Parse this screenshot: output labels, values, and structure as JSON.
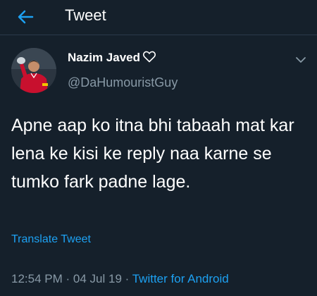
{
  "header": {
    "title": "Tweet",
    "back_icon": "arrow-left-icon"
  },
  "author": {
    "name": "Nazim Javed",
    "name_badge_icon": "heart-outline-icon",
    "handle": "@DaHumouristGuy"
  },
  "tweet": {
    "text": "Apne aap ko itna bhi tabaah mat kar lena ke kisi ke reply naa karne se tumko fark padne lage.",
    "translate_label": "Translate Tweet",
    "time": "12:54 PM",
    "date": "04 Jul 19",
    "separator": "·",
    "source": "Twitter for Android"
  },
  "colors": {
    "background": "#15202b",
    "accent": "#1da1f2",
    "secondary_text": "#8899a6"
  }
}
